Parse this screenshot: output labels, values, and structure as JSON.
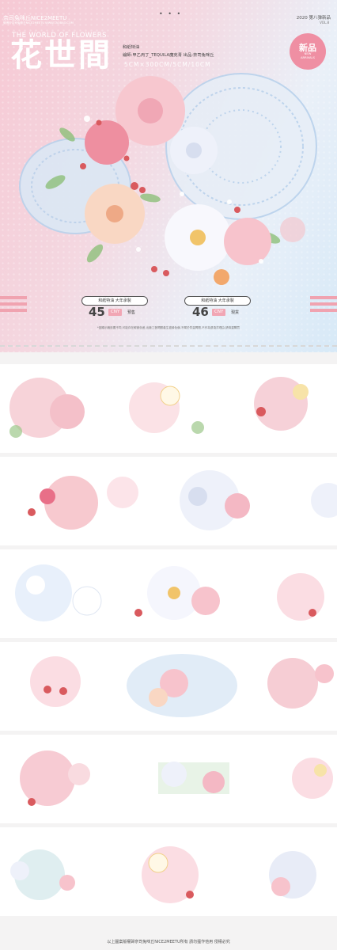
{
  "header": {
    "brand": "奈司兔咪丘NICE2MEETU",
    "brand_small": "微博@奈司兔咪丘NICE2MEETU  WWW.TAOBAO.COM",
    "nav_dots": "• • •",
    "year": "2020 第八弹新品",
    "vol": "VOL.8"
  },
  "hero": {
    "world": "THE WORLD OF FLOWERS",
    "title": "花世間",
    "info1": "和紙特油",
    "info2": "繪師:甲乙丙丁_TEQUILA魔克青  出品:奈司兔咪丘",
    "size": "5CM×300CM/5CM/10CM",
    "badge_main": "新品",
    "badge_sub1": "NEW",
    "badge_sub2": "ARRIVALS"
  },
  "products": [
    {
      "spec": "和紙特油  大年承製",
      "price": "45",
      "currency": "CNY",
      "status": "預售"
    },
    {
      "spec": "和紙特油  大年承製",
      "price": "46",
      "currency": "CNY",
      "status": "現貨"
    }
  ],
  "note": "*因顯示器設置不同,可能存在輕微色差,出廠工藝問題產生邊緣色偏,不屬於質量問題,不作為退換貨理由,請慎重購買",
  "footer": "以上圖案版權歸奈司兔咪丘NICE2MEETU所有  請勿擅作他用  侵權必究",
  "colors": {
    "accent": "#ef8fa3",
    "pink_bg": "#f6c9d4",
    "blue_bg": "#d7e9f7"
  },
  "illustration_rows": 6
}
